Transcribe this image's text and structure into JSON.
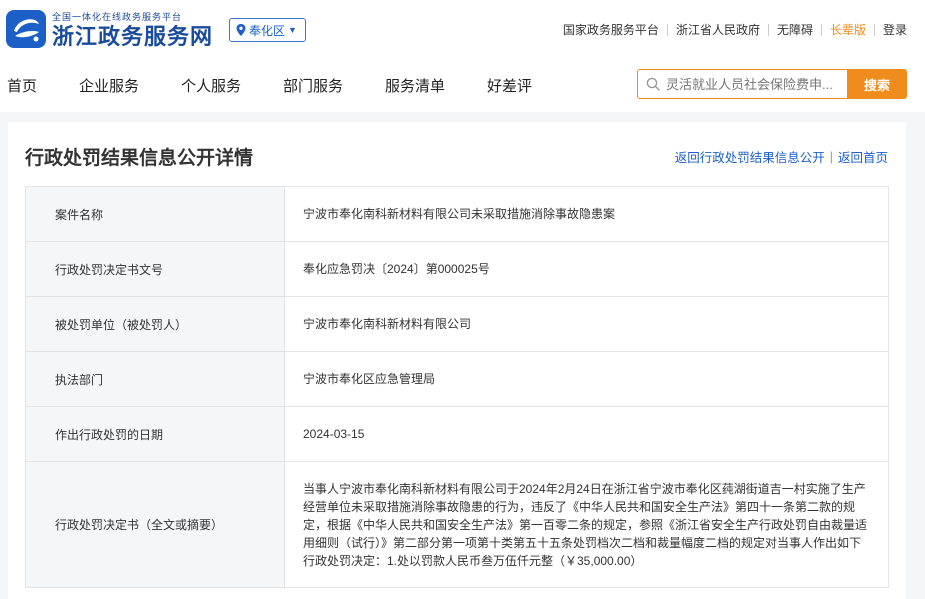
{
  "header": {
    "logo_small": "全国一体化在线政务服务平台",
    "logo_big": "浙江政务服务网",
    "region": "奉化区",
    "top_links": [
      "国家政务服务平台",
      "浙江省人民政府",
      "无障碍",
      "长辈版",
      "登录"
    ]
  },
  "nav": {
    "items": [
      "首页",
      "企业服务",
      "个人服务",
      "部门服务",
      "服务清单",
      "好差评"
    ],
    "search_placeholder": "灵活就业人员社会保险费申...",
    "search_button": "搜索"
  },
  "page": {
    "title": "行政处罚结果信息公开详情",
    "back_link": "返回行政处罚结果信息公开",
    "home_link": "返回首页"
  },
  "details": [
    {
      "label": "案件名称",
      "value": "宁波市奉化南科新材料有限公司未采取措施消除事故隐患案"
    },
    {
      "label": "行政处罚决定书文号",
      "value": "奉化应急罚决〔2024〕第000025号"
    },
    {
      "label": "被处罚单位（被处罚人）",
      "value": "宁波市奉化南科新材料有限公司"
    },
    {
      "label": "执法部门",
      "value": "宁波市奉化区应急管理局"
    },
    {
      "label": "作出行政处罚的日期",
      "value": "2024-03-15"
    },
    {
      "label": "行政处罚决定书（全文或摘要）",
      "value": "当事人宁波市奉化南科新材料有限公司于2024年2月24日在浙江省宁波市奉化区莼湖街道吉一村实施了生产经营单位未采取措施消除事故隐患的行为，违反了《中华人民共和国安全生产法》第四十一条第二款的规定，根据《中华人民共和国安全生产法》第一百零二条的规定，参照《浙江省安全生产行政处罚自由裁量适用细则（试行）》第二部分第一项第十类第五十五条处罚档次二档和裁量幅度二档的规定对当事人作出如下行政处罚决定：1.处以罚款人民币叁万伍仟元整（￥35,000.00）"
    }
  ],
  "colors": {
    "brand_blue": "#1b4c9c",
    "link_blue": "#1b5fc7",
    "accent_orange": "#f08c1b"
  }
}
